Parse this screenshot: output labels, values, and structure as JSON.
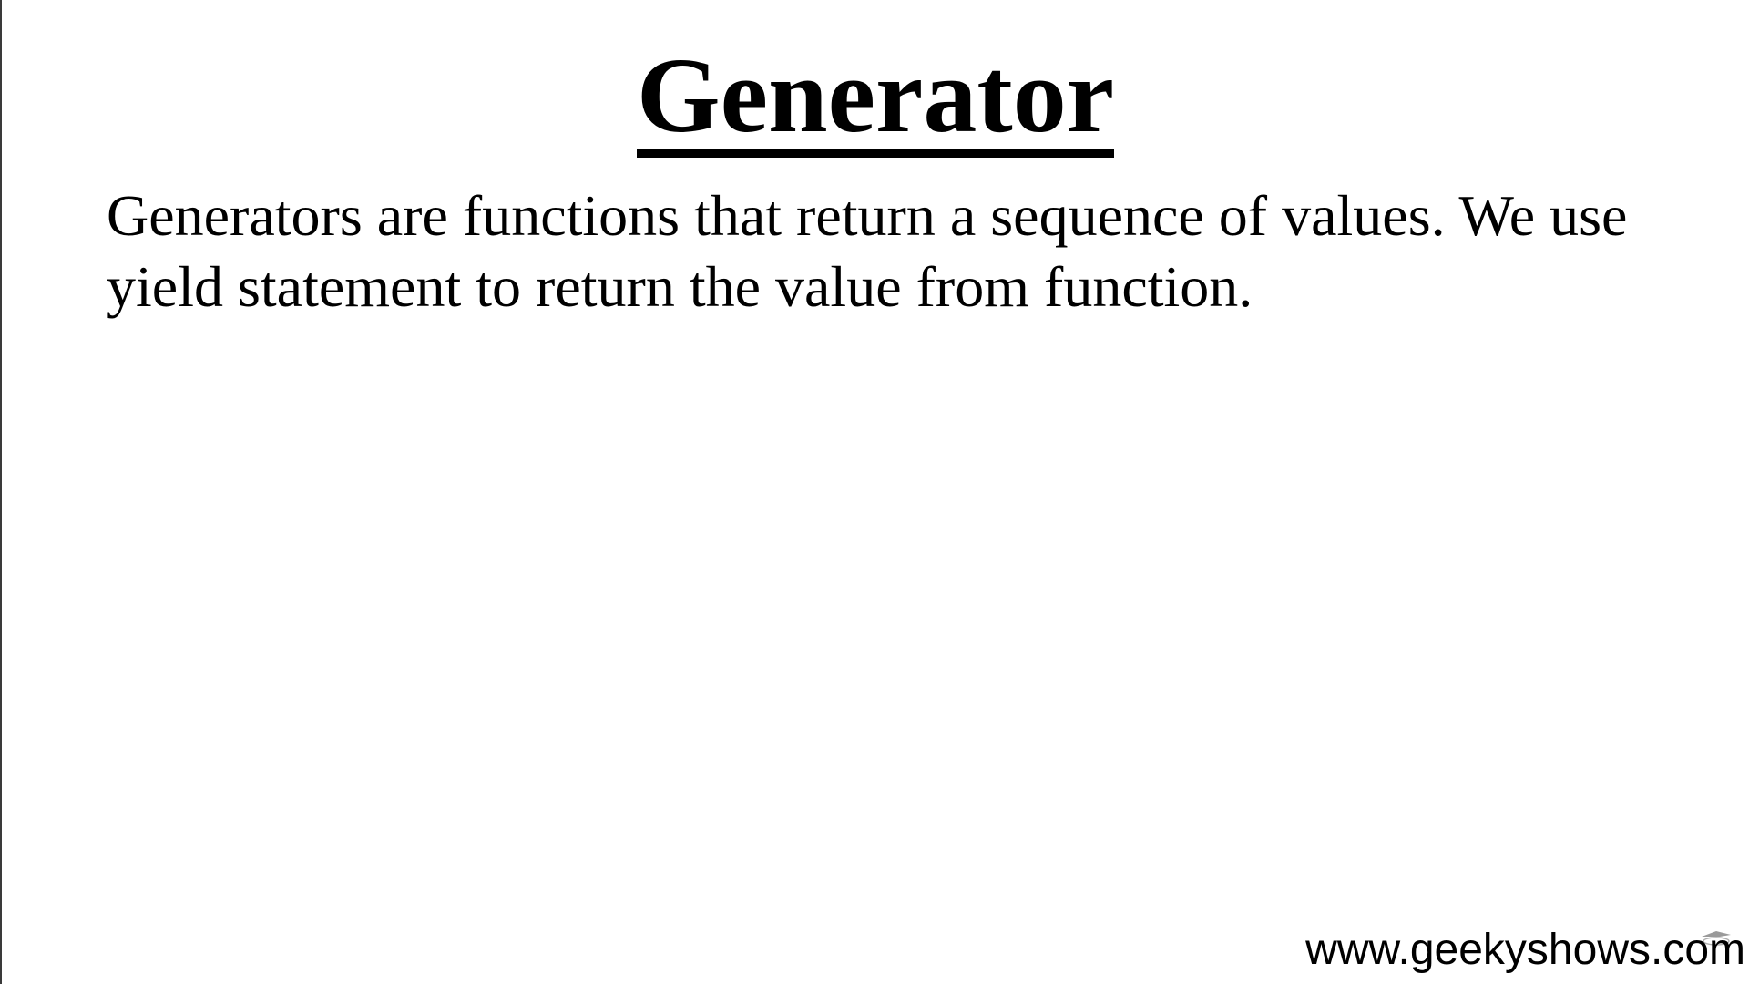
{
  "slide": {
    "title": "Generator",
    "body": "Generators are functions that return a sequence of values. We use yield statement to return the value from function.",
    "footer_url": "www.geekyshows.com"
  },
  "colors": {
    "background": "#ffffff",
    "text": "#000000"
  }
}
